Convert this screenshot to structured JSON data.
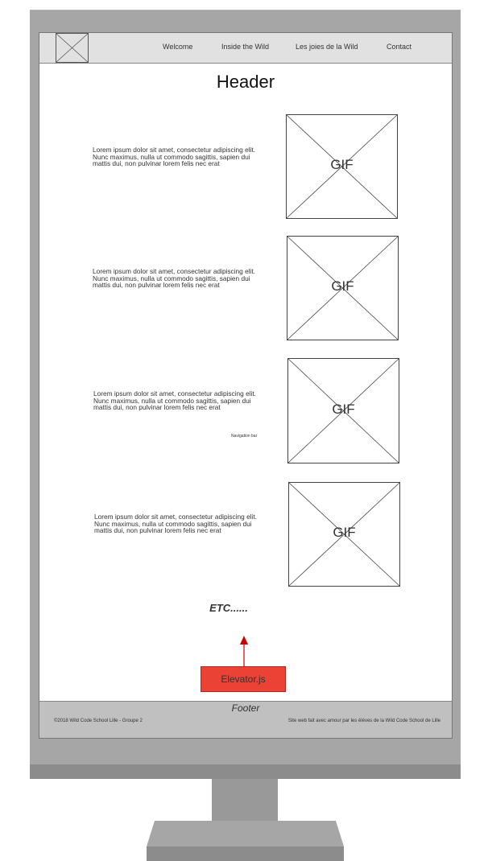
{
  "navbar": {
    "items": [
      "Welcome",
      "Inside the Wild",
      "Les joies de la Wild",
      "Contact"
    ]
  },
  "header": {
    "title": "Header"
  },
  "sections": [
    {
      "text": "Lorem ipsum dolor sit amet, consectetur adipiscing elit. Nunc maximus, nulla ut commodo sagittis, sapien dui mattis dui, non pulvinar lorem felis nec erat",
      "gif_label": "GIF"
    },
    {
      "text": "Lorem ipsum dolor sit amet, consectetur adipiscing elit. Nunc maximus, nulla ut commodo sagittis, sapien dui mattis dui, non pulvinar lorem felis nec erat",
      "gif_label": "GIF"
    },
    {
      "text": "Lorem ipsum dolor sit amet, consectetur adipiscing elit. Nunc maximus, nulla ut commodo sagittis, sapien dui mattis dui, non pulvinar lorem felis nec erat",
      "gif_label": "GIF"
    },
    {
      "text": "Lorem ipsum dolor sit amet, consectetur adipiscing elit. Nunc maximus, nulla ut commodo sagittis, sapien dui mattis dui, non pulvinar lorem felis nec erat",
      "gif_label": "GIF"
    }
  ],
  "nav_note": "Navigation bar",
  "etc": "ETC......",
  "elevator": {
    "label": "Elevator.js",
    "color": "#ea4235",
    "arrow_color": "#cc0000"
  },
  "footer": {
    "title": "Footer",
    "left": "©2018 Wild Code School Lille - Groupe 2",
    "right": "Site web fait avec amour par les élèves de la Wild Code School de Lille"
  }
}
